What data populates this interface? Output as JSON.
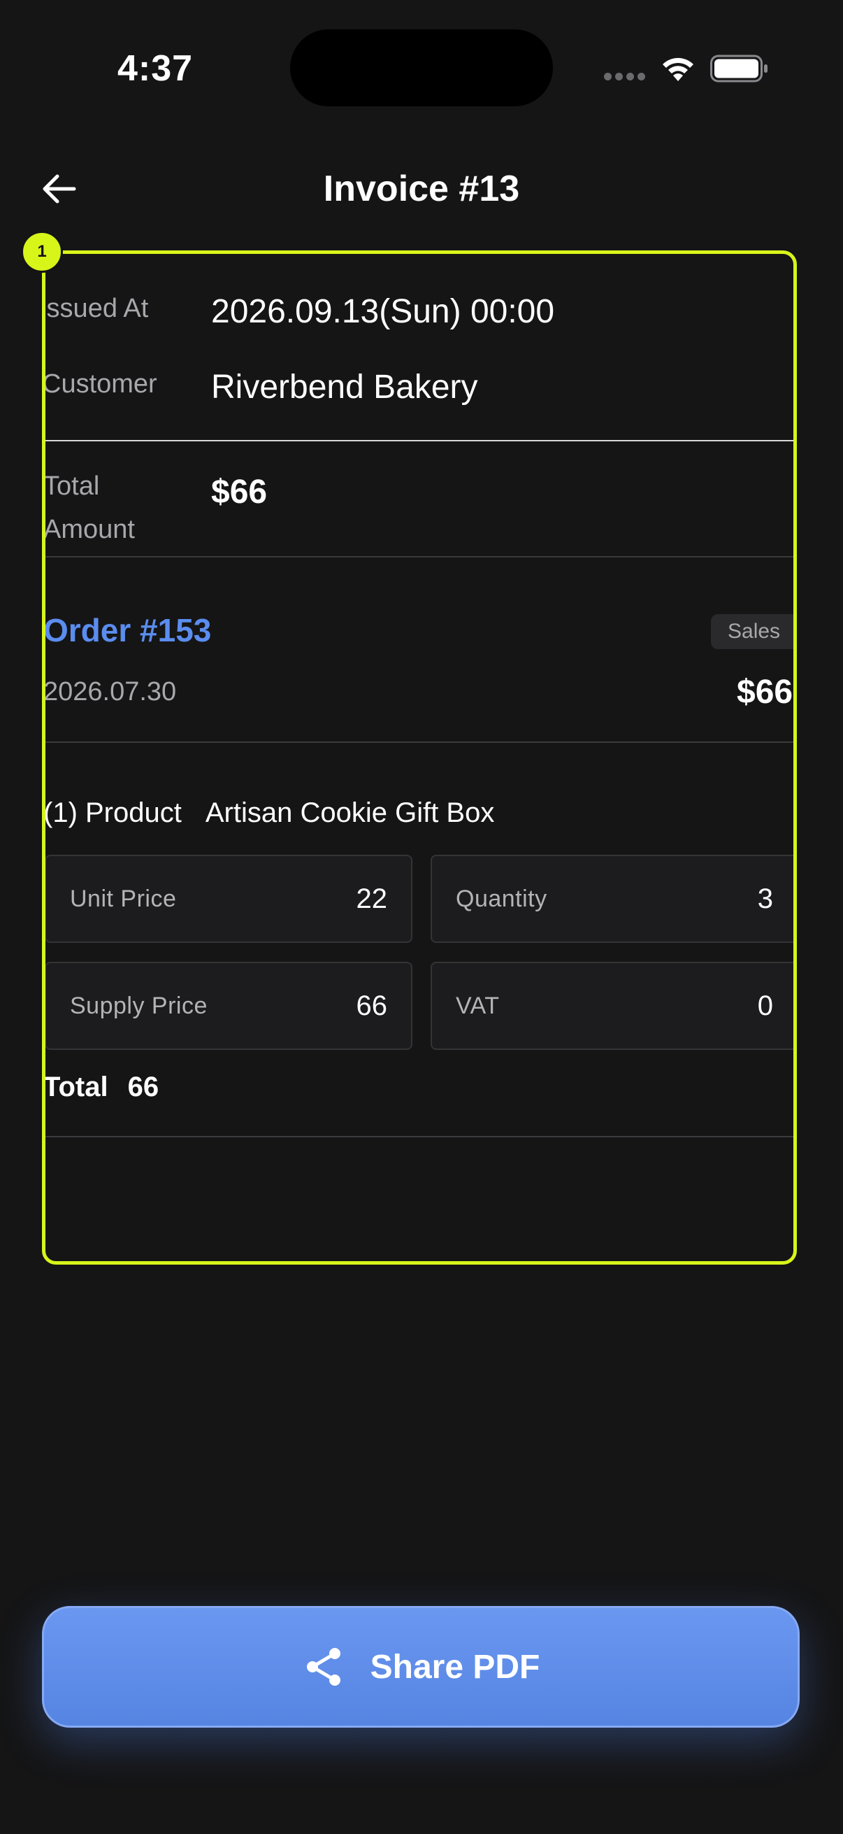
{
  "status_bar": {
    "time": "4:37"
  },
  "header": {
    "title": "Invoice #13",
    "back_icon": "arrow-left-icon"
  },
  "highlight": {
    "badge": "1",
    "color": "#d8f51a"
  },
  "invoice": {
    "issued_at_label": "Issued At",
    "issued_at_value": "2026.09.13(Sun) 00:00",
    "customer_label": "Customer",
    "customer_value": "Riverbend Bakery",
    "total_amount_label_line1": "Total",
    "total_amount_label_line2": "Amount",
    "total_amount_value": "$66"
  },
  "order": {
    "title": "Order #153",
    "badge": "Sales",
    "date": "2026.07.30",
    "amount": "$66"
  },
  "product": {
    "label": "(1) Product",
    "name": "Artisan Cookie Gift Box",
    "stats": [
      {
        "label": "Unit Price",
        "value": "22"
      },
      {
        "label": "Quantity",
        "value": "3"
      },
      {
        "label": "Supply Price",
        "value": "66"
      },
      {
        "label": "VAT",
        "value": "0"
      }
    ],
    "total_label": "Total",
    "total_value": "66"
  },
  "actions": {
    "share_label": "Share PDF",
    "share_icon": "share-icon",
    "accent": "#5b8def"
  }
}
